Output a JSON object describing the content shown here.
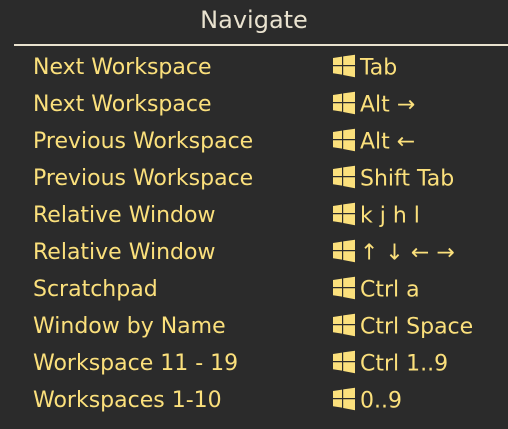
{
  "title": "Navigate",
  "icon": "windows-key-icon",
  "colors": {
    "background": "#2b2b2b",
    "title": "#e9e2cf",
    "text": "#fbe07c"
  },
  "shortcuts": [
    {
      "action": "Next Workspace",
      "keys": "Tab"
    },
    {
      "action": "Next Workspace",
      "keys": "Alt →"
    },
    {
      "action": "Previous Workspace",
      "keys": "Alt ←"
    },
    {
      "action": "Previous Workspace",
      "keys": "Shift Tab"
    },
    {
      "action": "Relative Window",
      "keys": "k j h l"
    },
    {
      "action": "Relative Window",
      "keys": "↑ ↓ ← →"
    },
    {
      "action": "Scratchpad",
      "keys": "Ctrl a"
    },
    {
      "action": "Window by Name",
      "keys": "Ctrl Space"
    },
    {
      "action": "Workspace 11 - 19",
      "keys": "Ctrl 1..9"
    },
    {
      "action": "Workspaces 1-10",
      "keys": "0..9"
    }
  ]
}
